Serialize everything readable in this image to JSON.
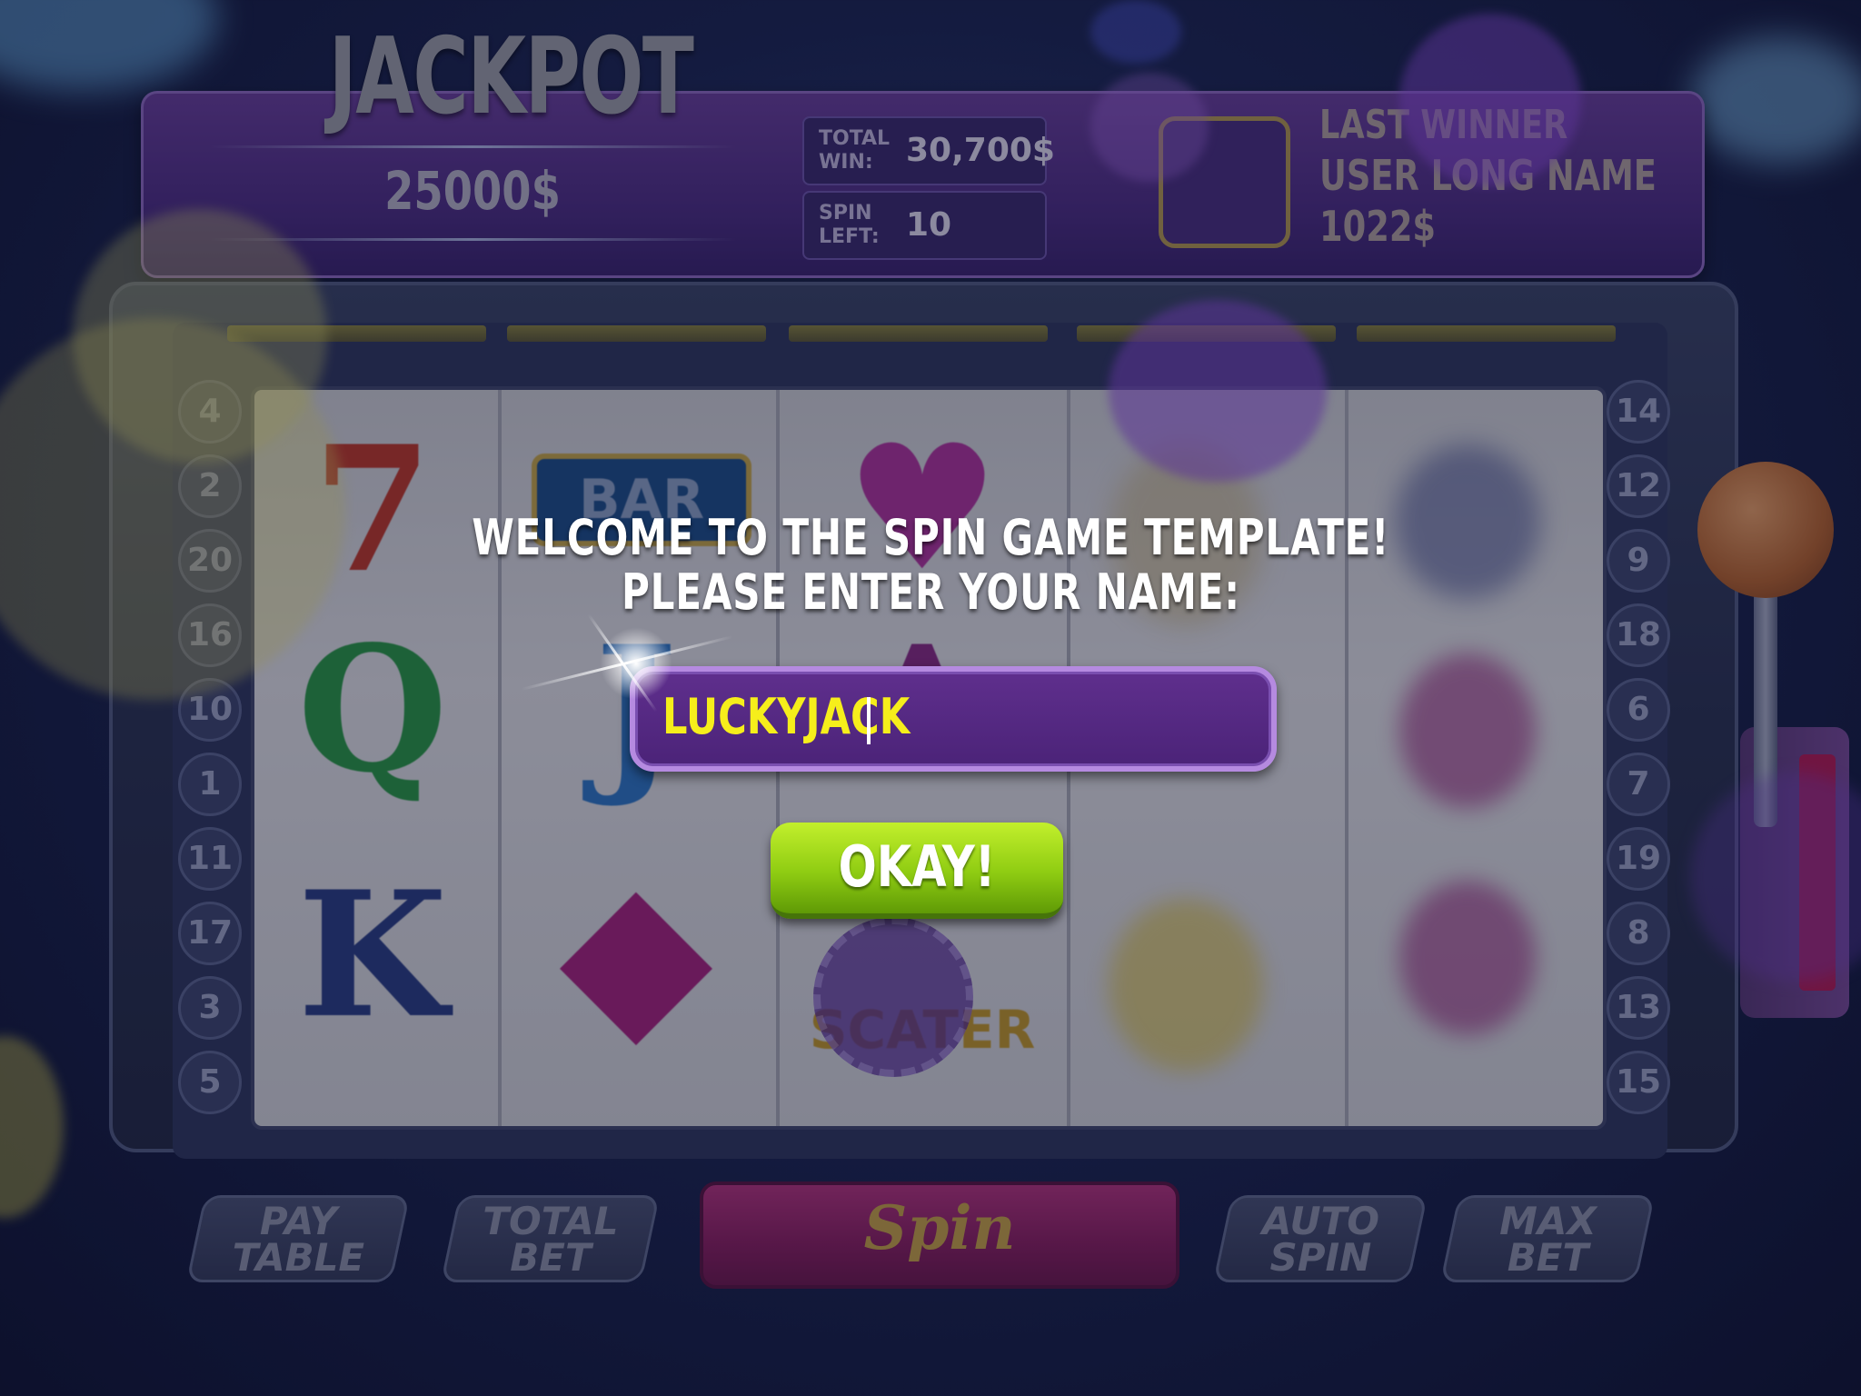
{
  "jackpot": {
    "title": "JACKPOT",
    "amount": "25000$"
  },
  "stats": {
    "total_win_label": "TOTAL WIN:",
    "total_win_value": "30,700$",
    "spin_left_label": "SPIN LEFT:",
    "spin_left_value": "10"
  },
  "last_winner": {
    "heading": "LAST WINNER",
    "name": "USER LONG NAME",
    "amount": "1022$"
  },
  "paylines": {
    "left": [
      "4",
      "2",
      "20",
      "16",
      "10",
      "1",
      "11",
      "17",
      "3",
      "5"
    ],
    "right": [
      "14",
      "12",
      "9",
      "18",
      "6",
      "7",
      "19",
      "8",
      "13",
      "15"
    ]
  },
  "reel_symbols": {
    "col1": [
      "7",
      "Q",
      "K"
    ],
    "col2": [
      "BAR",
      "J",
      "◆"
    ],
    "col3": [
      "♥",
      "A",
      "SCATER"
    ]
  },
  "controls": {
    "pay_table": "PAY TABLE",
    "total_bet": "TOTAL BET",
    "spin": "Spin",
    "auto_spin": "AUTO SPIN",
    "max_bet": "MAX BET"
  },
  "dialog": {
    "line1": "WELCOME TO THE SPIN GAME TEMPLATE!",
    "line2": "PLEASE ENTER YOUR NAME:",
    "name_value": "LUCKYJACK",
    "okay_label": "OKAY!"
  },
  "colors": {
    "accent_purple": "#6a3f9c",
    "okay_green": "#8fcc12",
    "input_text": "#f6ee1b"
  }
}
